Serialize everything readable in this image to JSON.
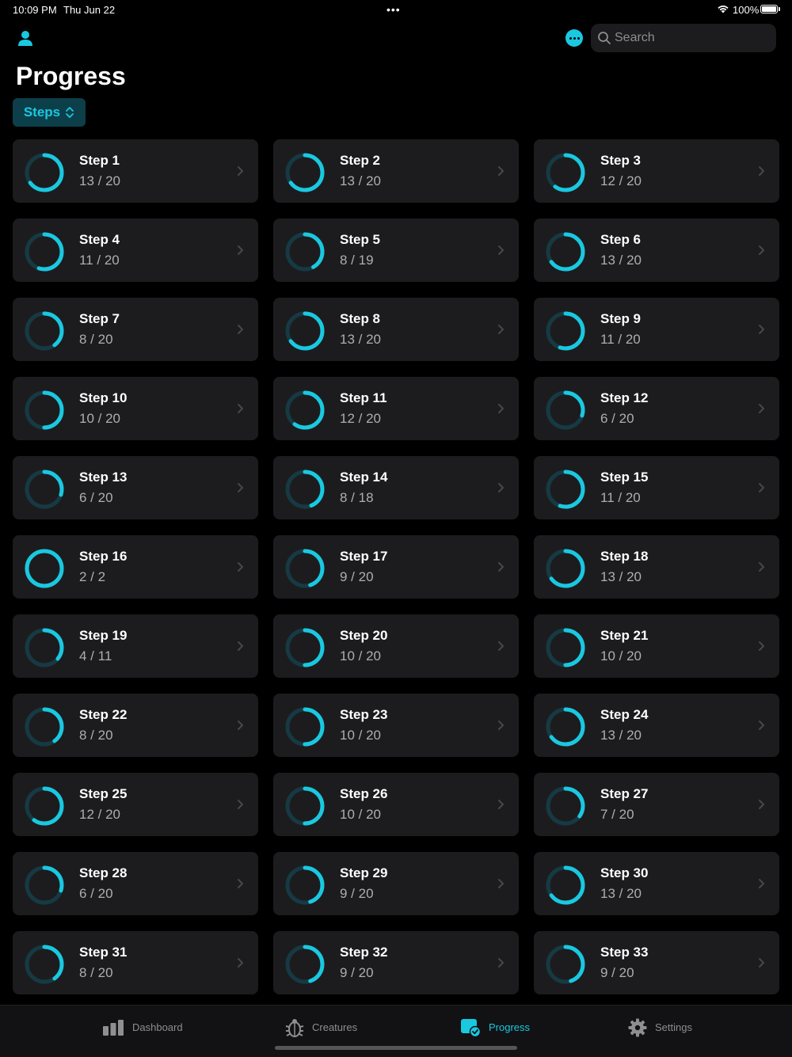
{
  "status_bar": {
    "time": "10:09 PM",
    "date": "Thu Jun 22",
    "battery": "100%"
  },
  "search": {
    "placeholder": "Search"
  },
  "page": {
    "title": "Progress",
    "filter_label": "Steps"
  },
  "colors": {
    "accent": "#1ac8e0",
    "ring_track": "#163a44",
    "card_bg": "#1c1c1e"
  },
  "steps": [
    {
      "label": "Step 1",
      "count": "13 / 20",
      "progress": 0.65
    },
    {
      "label": "Step 2",
      "count": "13 / 20",
      "progress": 0.65
    },
    {
      "label": "Step 3",
      "count": "12 / 20",
      "progress": 0.6
    },
    {
      "label": "Step 4",
      "count": "11 / 20",
      "progress": 0.55
    },
    {
      "label": "Step 5",
      "count": "8 / 19",
      "progress": 0.42
    },
    {
      "label": "Step 6",
      "count": "13 / 20",
      "progress": 0.65
    },
    {
      "label": "Step 7",
      "count": "8 / 20",
      "progress": 0.4
    },
    {
      "label": "Step 8",
      "count": "13 / 20",
      "progress": 0.65
    },
    {
      "label": "Step 9",
      "count": "11 / 20",
      "progress": 0.55
    },
    {
      "label": "Step 10",
      "count": "10 / 20",
      "progress": 0.5
    },
    {
      "label": "Step 11",
      "count": "12 / 20",
      "progress": 0.6
    },
    {
      "label": "Step 12",
      "count": "6 / 20",
      "progress": 0.3
    },
    {
      "label": "Step 13",
      "count": "6 / 20",
      "progress": 0.3
    },
    {
      "label": "Step 14",
      "count": "8 / 18",
      "progress": 0.44
    },
    {
      "label": "Step 15",
      "count": "11 / 20",
      "progress": 0.55
    },
    {
      "label": "Step 16",
      "count": "2 / 2",
      "progress": 1.0
    },
    {
      "label": "Step 17",
      "count": "9 / 20",
      "progress": 0.45
    },
    {
      "label": "Step 18",
      "count": "13 / 20",
      "progress": 0.65
    },
    {
      "label": "Step 19",
      "count": "4 / 11",
      "progress": 0.36
    },
    {
      "label": "Step 20",
      "count": "10 / 20",
      "progress": 0.5
    },
    {
      "label": "Step 21",
      "count": "10 / 20",
      "progress": 0.5
    },
    {
      "label": "Step 22",
      "count": "8 / 20",
      "progress": 0.4
    },
    {
      "label": "Step 23",
      "count": "10 / 20",
      "progress": 0.5
    },
    {
      "label": "Step 24",
      "count": "13 / 20",
      "progress": 0.65
    },
    {
      "label": "Step 25",
      "count": "12 / 20",
      "progress": 0.6
    },
    {
      "label": "Step 26",
      "count": "10 / 20",
      "progress": 0.5
    },
    {
      "label": "Step 27",
      "count": "7 / 20",
      "progress": 0.35
    },
    {
      "label": "Step 28",
      "count": "6 / 20",
      "progress": 0.3
    },
    {
      "label": "Step 29",
      "count": "9 / 20",
      "progress": 0.45
    },
    {
      "label": "Step 30",
      "count": "13 / 20",
      "progress": 0.65
    },
    {
      "label": "Step 31",
      "count": "8 / 20",
      "progress": 0.4
    },
    {
      "label": "Step 32",
      "count": "9 / 20",
      "progress": 0.45
    },
    {
      "label": "Step 33",
      "count": "9 / 20",
      "progress": 0.45
    }
  ],
  "tabs": [
    {
      "label": "Dashboard",
      "icon": "bar-chart-icon",
      "active": false
    },
    {
      "label": "Creatures",
      "icon": "bug-icon",
      "active": false
    },
    {
      "label": "Progress",
      "icon": "progress-check-icon",
      "active": true
    },
    {
      "label": "Settings",
      "icon": "gear-icon",
      "active": false
    }
  ]
}
